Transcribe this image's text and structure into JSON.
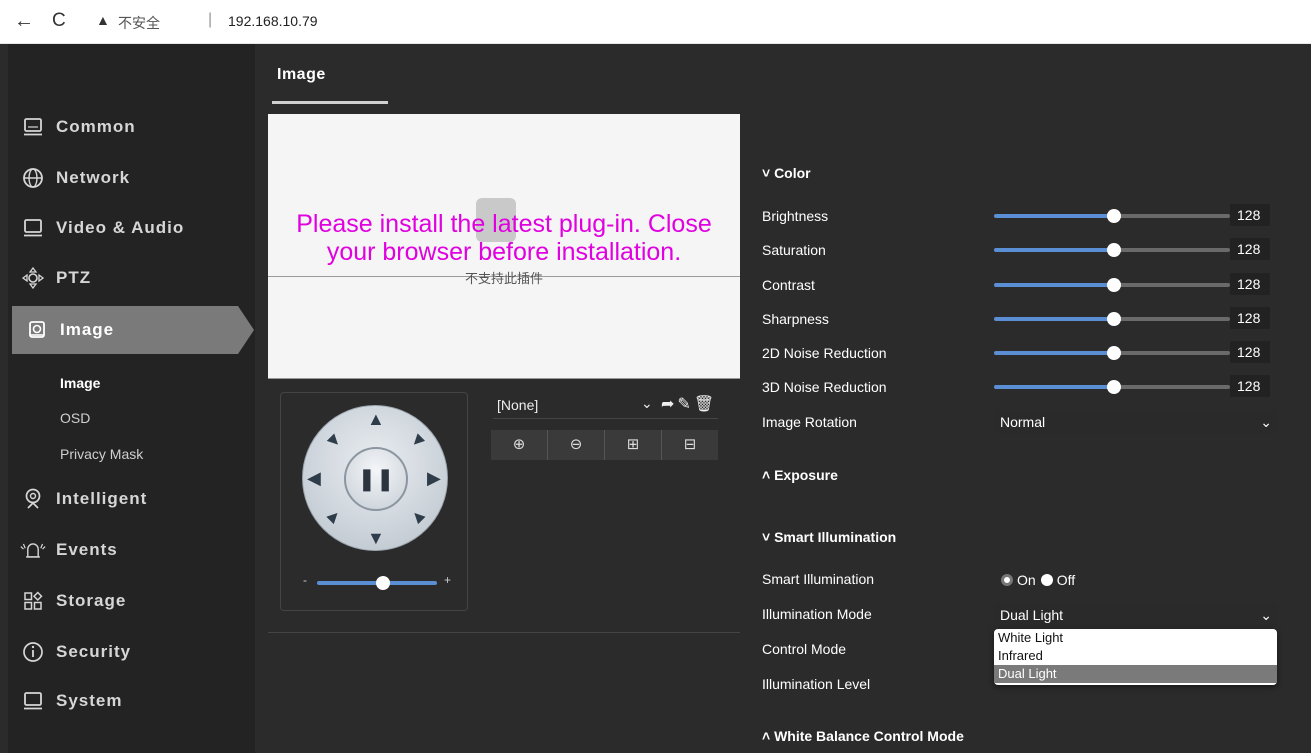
{
  "browser": {
    "back_glyph": "←",
    "reload_glyph": "C",
    "warning_glyph": "▲",
    "insecure_label": "不安全",
    "separator": "|",
    "url": "192.168.10.79"
  },
  "sidebar": {
    "items": [
      {
        "label": "Common",
        "icon": "monitor-icon"
      },
      {
        "label": "Network",
        "icon": "globe-icon"
      },
      {
        "label": "Video & Audio",
        "icon": "monitor-icon"
      },
      {
        "label": "PTZ",
        "icon": "ptz-icon"
      },
      {
        "label": "Image",
        "icon": "camera-icon"
      },
      {
        "label": "Intelligent",
        "icon": "webcam-icon"
      },
      {
        "label": "Events",
        "icon": "alarm-icon"
      },
      {
        "label": "Storage",
        "icon": "storage-icon"
      },
      {
        "label": "Security",
        "icon": "info-icon"
      },
      {
        "label": "System",
        "icon": "monitor-icon"
      }
    ],
    "subitems": [
      "Image",
      "OSD",
      "Privacy Mask"
    ],
    "active_item": "Image",
    "active_subitem": "Image"
  },
  "main": {
    "tab_title": "Image",
    "plugin_message_line1": "Please install the latest plug-in. Close",
    "plugin_message_line2": "your browser before installation.",
    "plugin_unsupported": "不支持此插件",
    "ptz": {
      "pause_glyph": "❚❚",
      "zoom_minus": "-",
      "zoom_plus": "+",
      "zoom_level": 0.55
    },
    "preset": {
      "selected": "[None]",
      "chevron": "⌄",
      "actions": "➦✎🗑"
    },
    "zoom_buttons": [
      "⊕",
      "⊖",
      "⊞",
      "⊟"
    ]
  },
  "settings": {
    "color_section": "˅ Color",
    "brightness_label": "Brightness",
    "brightness_value": "128",
    "saturation_label": "Saturation",
    "saturation_value": "128",
    "contrast_label": "Contrast",
    "contrast_value": "128",
    "sharpness_label": "Sharpness",
    "sharpness_value": "128",
    "noise2d_label": "2D Noise Reduction",
    "noise2d_value": "128",
    "noise3d_label": "3D Noise Reduction",
    "noise3d_value": "128",
    "rotation_label": "Image Rotation",
    "rotation_value": "Normal",
    "exposure_section": "˄ Exposure",
    "smart_section": "˅ Smart Illumination",
    "smart_label": "Smart Illumination",
    "smart_on": "On",
    "smart_off": "Off",
    "illum_mode_label": "Illumination Mode",
    "illum_mode_value": "Dual Light",
    "illum_mode_options": [
      "White Light",
      "Infrared",
      "Dual Light"
    ],
    "control_mode_label": "Control Mode",
    "illum_level_label": "Illumination Level",
    "wb_section": "˄ White Balance Control Mode",
    "chevron": "⌄"
  },
  "colors": {
    "accent_blue": "#5a8fd6",
    "plugin_message": "#e000e0",
    "sidebar_bg": "#232323",
    "active_item_bg": "#7a7a7a"
  }
}
